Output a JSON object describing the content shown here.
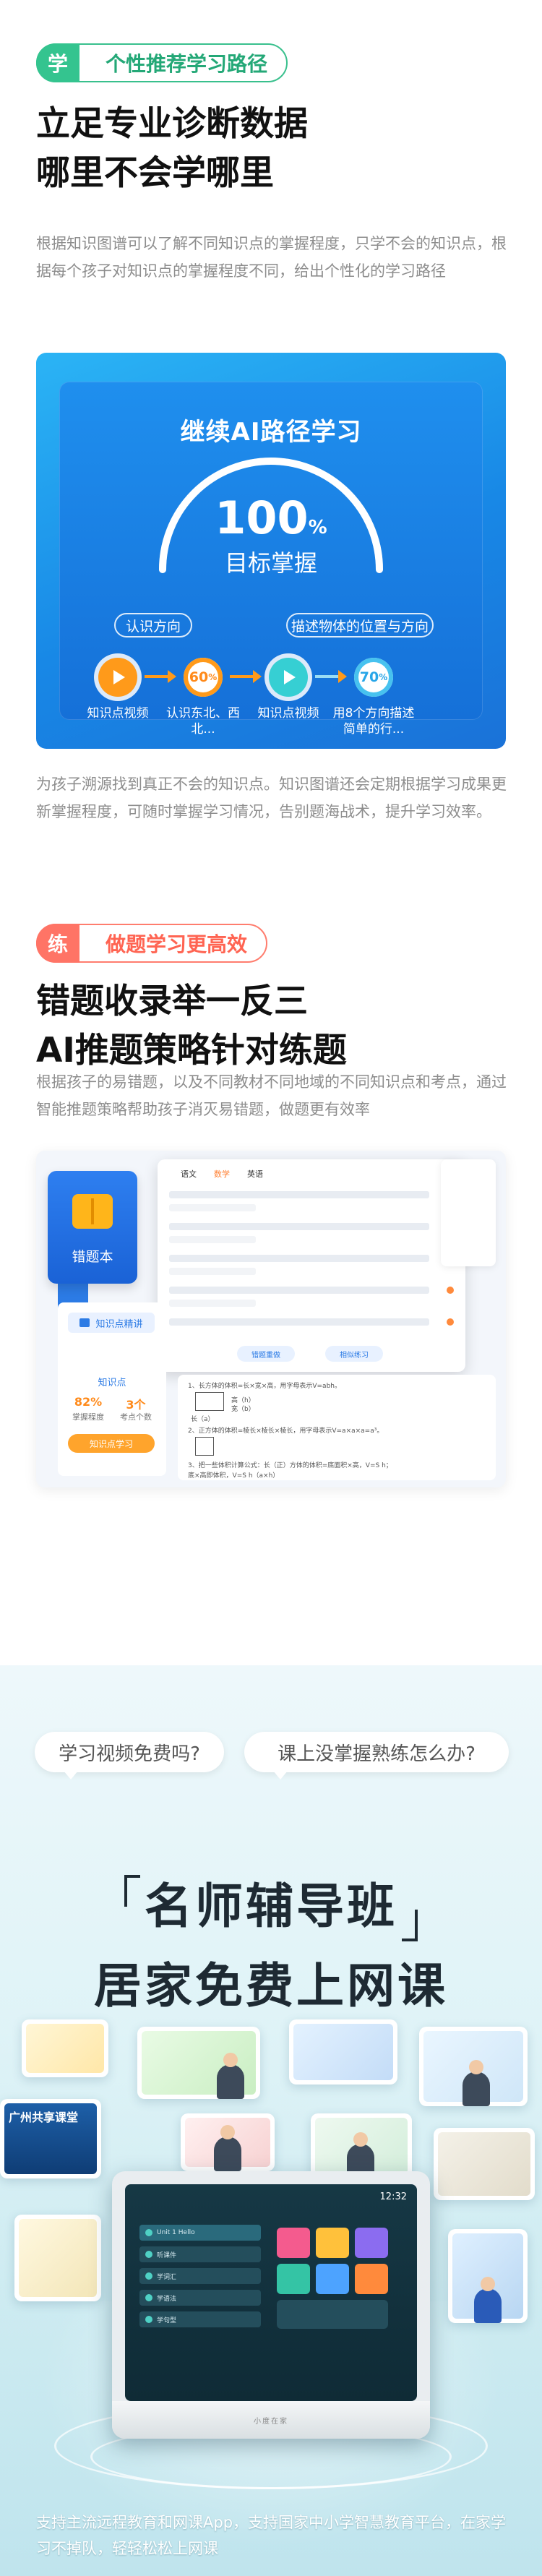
{
  "section1": {
    "badge": "学",
    "pill": "个性推荐学习路径",
    "headline1": "立足专业诊断数据",
    "headline2": "哪里不会学哪里",
    "desc": "根据知识图谱可以了解不同知识点的掌握程度，只学不会的知识点，根据每个孩子对知识点的掌握程度不同，给出个性化的学习路径",
    "panel": {
      "title": "继续AI路径学习",
      "percent": "100",
      "percent_unit": "%",
      "goal": "目标掌握",
      "tag_left": "认识方向",
      "tag_right": "描述物体的位置与方向",
      "nodes": [
        {
          "label": "知识点视频"
        },
        {
          "value": "60",
          "unit": "%",
          "label": "认识东北、西北..."
        },
        {
          "label": "知识点视频"
        },
        {
          "value": "70",
          "unit": "%",
          "label": "用8个方向描述简单的行..."
        }
      ]
    },
    "caption": "为孩子溯源找到真正不会的知识点。知识图谱还会定期根据学习成果更新掌握程度，可随时掌握学习情况，告别题海战术，提升学习效率。"
  },
  "section2": {
    "badge": "练",
    "pill": "做题学习更高效",
    "headline1": "错题收录举一反三",
    "headline2": "AI推题策略针对练题",
    "desc": "根据孩子的易错题，以及不同教材不同地域的不同知识点和考点，通过智能推题策略帮助孩子消灭易错题，做题更有效率",
    "mock": {
      "book_label": "错题本",
      "tabs": [
        "语文",
        "数学",
        "英语"
      ],
      "active_tab": "数学",
      "btn_a": "错题重做",
      "btn_b": "相似练习",
      "knowledge_btn": "知识点精讲",
      "knowledge_title": "知识点",
      "stat1_value": "82%",
      "stat1_label": "掌握程度",
      "stat2_value": "3个",
      "stat2_label": "考点个数",
      "learn_btn": "知识点学习",
      "lines": [
        "1、长方体的体积=长×宽×高，用字母表示V=abh。",
        "2、正方体的体积=棱长×棱长×棱长，用字母表示V=a×a×a=a³。",
        "3、把一些体积计算公式：长（正）方体的体积=底面积×高，V=S h；",
        "底×高即体积，V=S h（a×h）"
      ],
      "label_high": "高（h）",
      "label_wide": "宽（b）",
      "label_long": "长（a）"
    }
  },
  "section3": {
    "bubble1": "学习视频免费吗?",
    "bubble2": "课上没掌握熟练怎么办?",
    "title1": "名师辅导班",
    "title2": "居家免费上网课",
    "card_label": "广州共享课堂",
    "device_time": "12:32",
    "device_list": [
      "Unit 1 Hello",
      "听课件",
      "学词汇",
      "学语法",
      "学句型"
    ],
    "device_logo": "小度在家",
    "footer": "支持主流远程教育和网课App，支持国家中小学智慧教育平台，在家学习不掉队，轻轻松松上网课"
  },
  "colors": {
    "green": "#34c48f",
    "red": "#ff7466",
    "blue": "#1f8fee",
    "orange": "#ff9a1a"
  }
}
